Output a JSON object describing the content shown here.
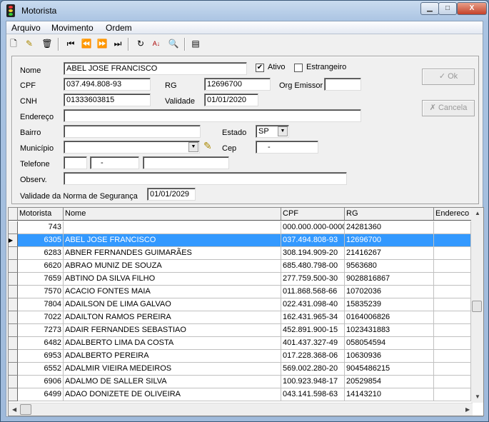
{
  "window": {
    "title": "Motorista",
    "icon": "traffic-light-icon",
    "controls": [
      "minimize",
      "maximize",
      "close"
    ]
  },
  "menu": [
    "Arquivo",
    "Movimento",
    "Ordem"
  ],
  "toolbar": [
    "new-icon",
    "edit-icon",
    "delete-icon",
    "first-icon",
    "prior-icon",
    "next-icon",
    "last-icon",
    "refresh-icon",
    "sort-az-icon",
    "find-icon",
    "properties-icon"
  ],
  "form": {
    "nome_label": "Nome",
    "nome": "ABEL JOSE FRANCISCO",
    "ativo_label": "Ativo",
    "ativo": true,
    "estrangeiro_label": "Estrangeiro",
    "estrangeiro": false,
    "cpf_label": "CPF",
    "cpf": "037.494.808-93",
    "rg_label": "RG",
    "rg": "12696700",
    "org_label": "Org Emissor",
    "org": "",
    "cnh_label": "CNH",
    "cnh": "01333603815",
    "validade_label": "Validade",
    "validade": "01/01/2020",
    "endereco_label": "Endereço",
    "endereco": "",
    "bairro_label": "Bairro",
    "bairro": "",
    "estado_label": "Estado",
    "estado": "SP",
    "municipio_label": "Município",
    "municipio": "",
    "cep_label": "Cep",
    "cep": "-",
    "telefone_label": "Telefone",
    "tel_ddd": "",
    "tel_num": "-",
    "tel_extra": "",
    "obs_label": "Observ.",
    "obs": "",
    "norma_label": "Validade da Norma de Segurança",
    "norma": "01/01/2029",
    "ok_label": "Ok",
    "cancela_label": "Cancela"
  },
  "grid": {
    "columns": [
      "Motorista",
      "Nome",
      "CPF",
      "RG",
      "Endereco"
    ],
    "selected_index": 1,
    "rows": [
      [
        "743",
        "",
        "000.000.000-0000",
        "24281360",
        ""
      ],
      [
        "6305",
        "ABEL JOSE FRANCISCO",
        "037.494.808-93",
        "12696700",
        ""
      ],
      [
        "6283",
        "ABNER FERNANDES GUIMARÃES",
        "308.194.909-20",
        "21416267",
        ""
      ],
      [
        "6620",
        "ABRAO MUNIZ DE SOUZA",
        "685.480.798-00",
        "9563680",
        ""
      ],
      [
        "7659",
        "ABTINO DA SILVA FILHO",
        "277.759.500-30",
        "9028816867",
        ""
      ],
      [
        "7570",
        "ACACIO FONTES MAIA",
        "011.868.568-66",
        "10702036",
        ""
      ],
      [
        "7804",
        "ADAILSON DE LIMA GALVAO",
        "022.431.098-40",
        "15835239",
        ""
      ],
      [
        "7022",
        "ADAILTON RAMOS PEREIRA",
        "162.431.965-34",
        "0164006826",
        ""
      ],
      [
        "7273",
        "ADAIR FERNANDES SEBASTIAO",
        "452.891.900-15",
        "1023431883",
        ""
      ],
      [
        "6482",
        "ADALBERTO LIMA DA COSTA",
        "401.437.327-49",
        "058054594",
        ""
      ],
      [
        "6953",
        "ADALBERTO PEREIRA",
        "017.228.368-06",
        "10630936",
        ""
      ],
      [
        "6552",
        "ADALMIR VIEIRA MEDEIROS",
        "569.002.280-20",
        "9045486215",
        ""
      ],
      [
        "6906",
        "ADALMO DE SALLER SILVA",
        "100.923.948-17",
        "20529854",
        ""
      ],
      [
        "6499",
        "ADAO DONIZETE DE OLIVEIRA",
        "043.141.598-63",
        "14143210",
        ""
      ]
    ]
  }
}
